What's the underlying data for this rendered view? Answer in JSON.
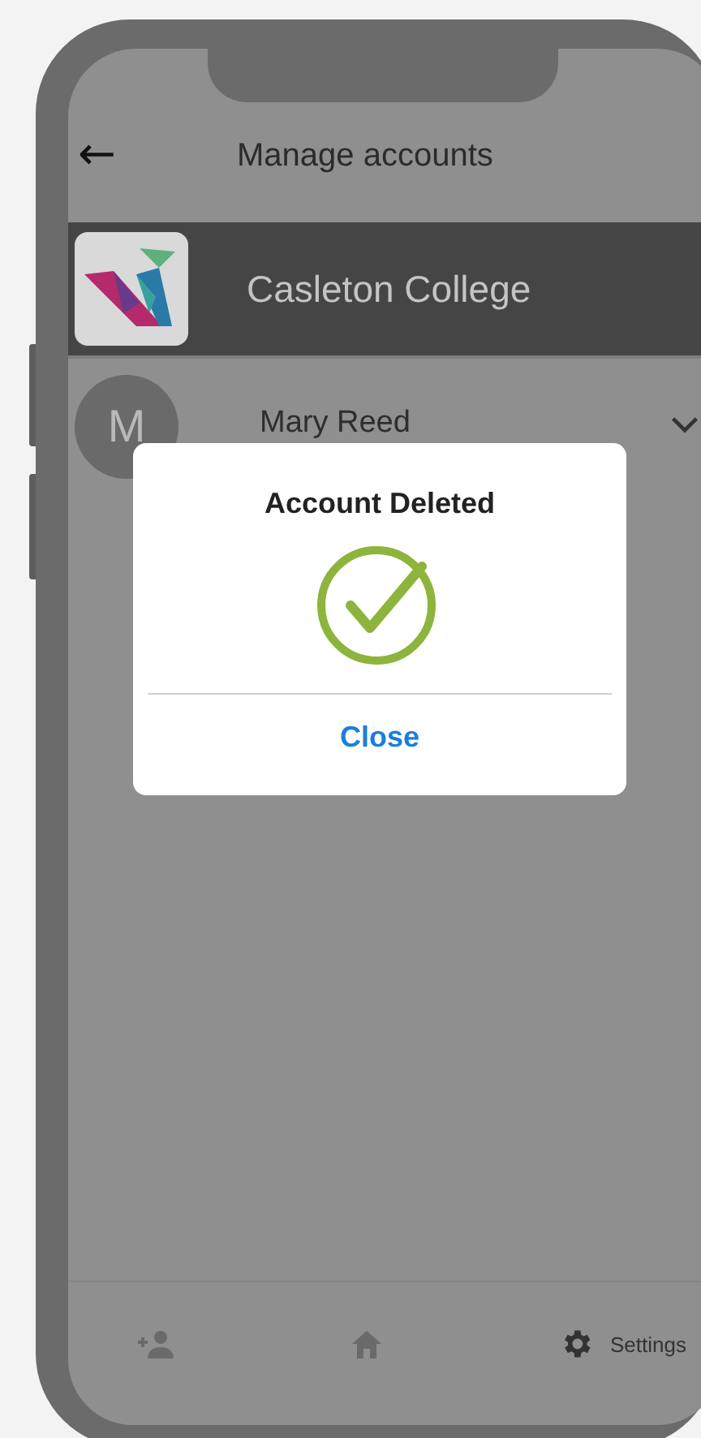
{
  "header": {
    "back_icon": "←",
    "title": "Manage accounts"
  },
  "accounts": [
    {
      "kind": "organization",
      "name": "Casleton College",
      "selected": true
    },
    {
      "kind": "person",
      "initial": "M",
      "name": "Mary Reed",
      "selected": false
    }
  ],
  "dialog": {
    "title": "Account Deleted",
    "button": "Close"
  },
  "nav": [
    {
      "kind": "add-person"
    },
    {
      "kind": "home"
    },
    {
      "kind": "settings",
      "label": "Settings"
    }
  ]
}
